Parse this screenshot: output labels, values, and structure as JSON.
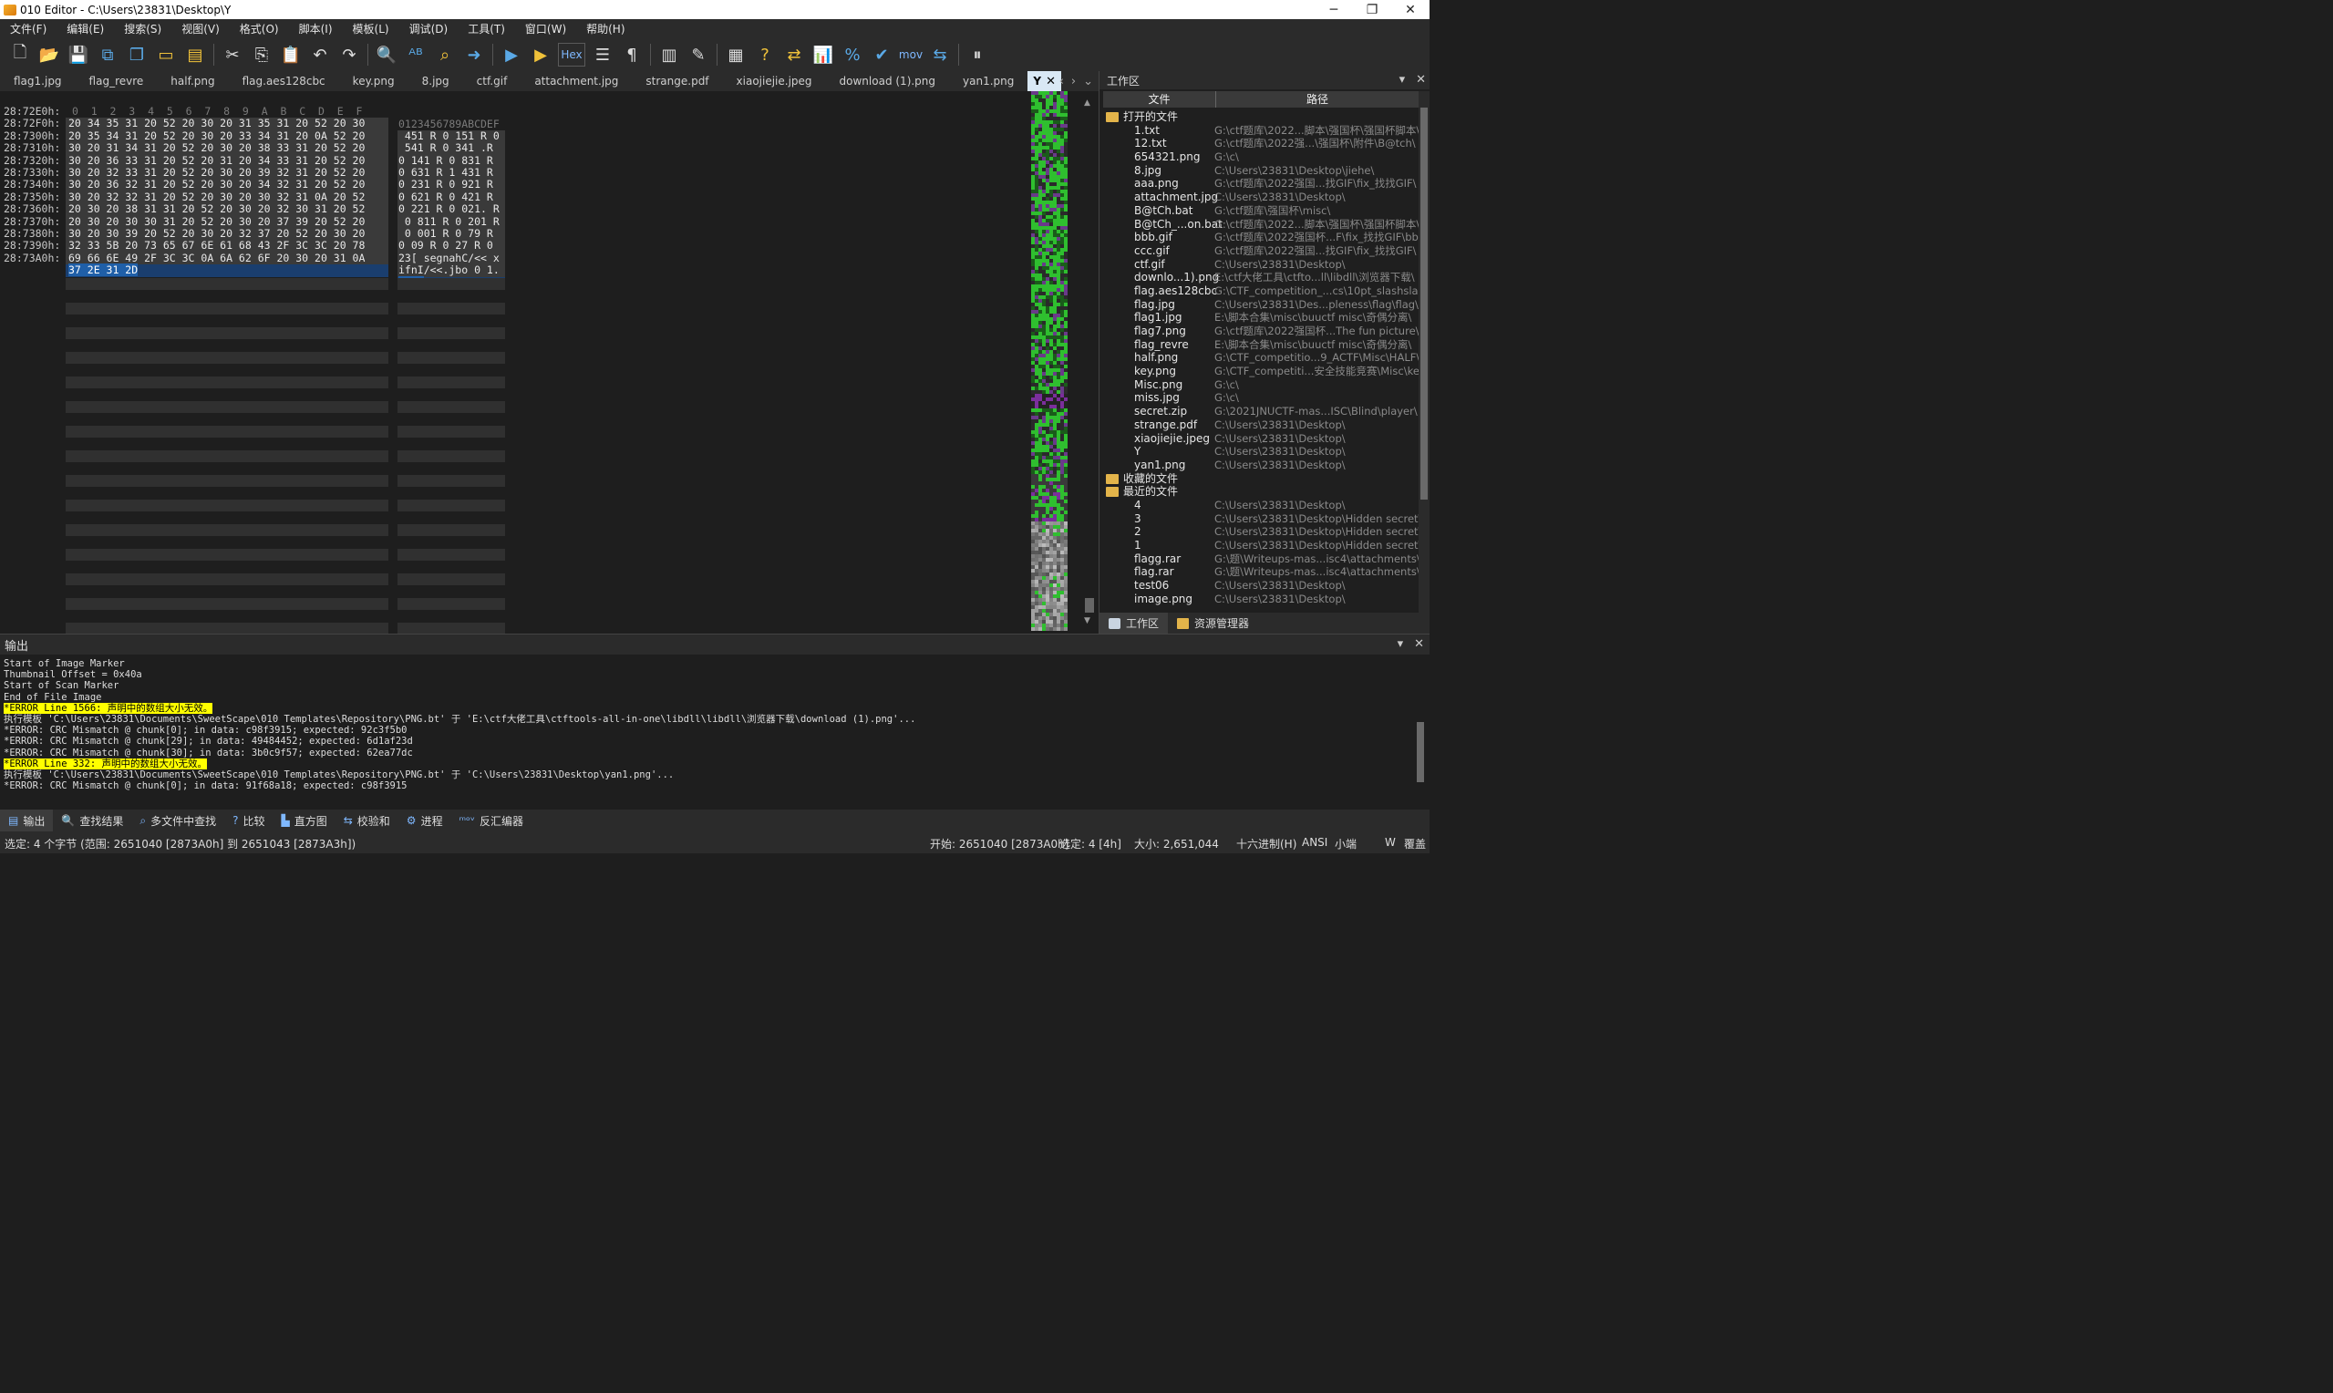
{
  "window": {
    "title": "010 Editor - C:\\Users\\23831\\Desktop\\Y",
    "minimize": "─",
    "maximize": "❐",
    "close": "✕"
  },
  "menu": [
    "文件(F)",
    "编辑(E)",
    "搜索(S)",
    "视图(V)",
    "格式(O)",
    "脚本(I)",
    "模板(L)",
    "调试(D)",
    "工具(T)",
    "窗口(W)",
    "帮助(H)"
  ],
  "toolbar": {
    "hex_label": "Hex",
    "mov_label": "mov",
    "icons": [
      "new-file-icon",
      "open-folder-icon",
      "save-icon",
      "save-as-icon",
      "save-all-icon",
      "open-dir-icon",
      "folders-icon",
      "cut-icon",
      "copy-icon",
      "paste-icon",
      "undo-icon",
      "redo-icon",
      "find-icon",
      "replace-icon",
      "find-in-files-icon",
      "goto-icon",
      "run-script-icon",
      "run-template-icon",
      "hex-mode-icon",
      "text-mode-icon",
      "pilcrow-icon",
      "columns-icon",
      "highlight-icon",
      "calculator-icon",
      "inspector-icon",
      "compare-icon",
      "histogram-icon",
      "percent-icon",
      "checksum-icon",
      "mov-icon",
      "base-convert-icon",
      "pause-icon"
    ]
  },
  "tabs": [
    {
      "label": "flag1.jpg"
    },
    {
      "label": "flag_revre"
    },
    {
      "label": "half.png"
    },
    {
      "label": "flag.aes128cbc"
    },
    {
      "label": "key.png"
    },
    {
      "label": "8.jpg"
    },
    {
      "label": "ctf.gif"
    },
    {
      "label": "attachment.jpg"
    },
    {
      "label": "strange.pdf"
    },
    {
      "label": "xiaojiejie.jpeg"
    },
    {
      "label": "download (1).png"
    },
    {
      "label": "yan1.png"
    },
    {
      "label": "Y",
      "active": true
    }
  ],
  "hex": {
    "header_offsets": "0  1  2  3  4  5  6  7  8  9  A  B  C  D  E  F",
    "header_ascii": "0123456789ABCDEF",
    "rows": [
      {
        "addr": "28:72E0h:",
        "bytes": "20 34 35 31 20 52 20 30 20 31 35 31 20 52 20 30",
        "ascii": " 451 R 0 151 R 0"
      },
      {
        "addr": "28:72F0h:",
        "bytes": "20 35 34 31 20 52 20 30 20 33 34 31 20 0A 52 20",
        "ascii": " 541 R 0 341 .R "
      },
      {
        "addr": "28:7300h:",
        "bytes": "30 20 31 34 31 20 52 20 30 20 38 33 31 20 52 20",
        "ascii": "0 141 R 0 831 R "
      },
      {
        "addr": "28:7310h:",
        "bytes": "30 20 36 33 31 20 52 20 31 20 34 33 31 20 52 20",
        "ascii": "0 631 R 1 431 R "
      },
      {
        "addr": "28:7320h:",
        "bytes": "30 20 32 33 31 20 52 20 30 20 39 32 31 20 52 20",
        "ascii": "0 231 R 0 921 R "
      },
      {
        "addr": "28:7330h:",
        "bytes": "30 20 36 32 31 20 52 20 30 20 34 32 31 20 52 20",
        "ascii": "0 621 R 0 421 R "
      },
      {
        "addr": "28:7340h:",
        "bytes": "30 20 32 32 31 20 52 20 30 20 30 32 31 0A 20 52",
        "ascii": "0 221 R 0 021. R"
      },
      {
        "addr": "28:7350h:",
        "bytes": "20 30 20 38 31 31 20 52 20 30 20 32 30 31 20 52",
        "ascii": " 0 811 R 0 201 R"
      },
      {
        "addr": "28:7360h:",
        "bytes": "20 30 20 30 30 31 20 52 20 30 20 37 39 20 52 20",
        "ascii": " 0 001 R 0 79 R "
      },
      {
        "addr": "28:7370h:",
        "bytes": "30 20 30 39 20 52 20 30 20 32 37 20 52 20 30 20",
        "ascii": "0 09 R 0 27 R 0 "
      },
      {
        "addr": "28:7380h:",
        "bytes": "32 33 5B 20 73 65 67 6E 61 68 43 2F 3C 3C 20 78",
        "ascii": "23[ segnahC/<< x"
      },
      {
        "addr": "28:7390h:",
        "bytes": "69 66 6E 49 2F 3C 3C 0A 6A 62 6F 20 30 20 31 0A",
        "ascii": "ifnI/<<.jbo 0 1."
      },
      {
        "addr": "28:73A0h:",
        "bytes": "37 2E 31 2D",
        "ascii": "7.1-",
        "selected": true
      }
    ]
  },
  "workspace": {
    "title": "工作区",
    "col_file": "文件",
    "col_path": "路径",
    "group_open": "打开的文件",
    "open_files": [
      {
        "name": "1.txt",
        "path": "G:\\ctf题库\\2022...脚本\\强国杯\\强国杯脚本\\"
      },
      {
        "name": "12.txt",
        "path": "G:\\ctf题库\\2022强...\\强国杯\\附件\\B@tch\\"
      },
      {
        "name": "654321.png",
        "path": "G:\\c\\"
      },
      {
        "name": "8.jpg",
        "path": "C:\\Users\\23831\\Desktop\\jiehe\\"
      },
      {
        "name": "aaa.png",
        "path": "G:\\ctf题库\\2022强国...找GIF\\fix_找找GIF\\"
      },
      {
        "name": "attachment.jpg",
        "path": "C:\\Users\\23831\\Desktop\\"
      },
      {
        "name": "B@tCh.bat",
        "path": "G:\\ctf题库\\强国杯\\misc\\"
      },
      {
        "name": "B@tCh_...on.bat",
        "path": "G:\\ctf题库\\2022...脚本\\强国杯\\强国杯脚本\\"
      },
      {
        "name": "bbb.gif",
        "path": "G:\\ctf题库\\2022强国杯...F\\fix_找找GIF\\bbb\\"
      },
      {
        "name": "ccc.gif",
        "path": "G:\\ctf题库\\2022强国...找GIF\\fix_找找GIF\\"
      },
      {
        "name": "ctf.gif",
        "path": "C:\\Users\\23831\\Desktop\\"
      },
      {
        "name": "downlo...1).png",
        "path": "E:\\ctf大佬工具\\ctfto...ll\\libdll\\浏览器下载\\"
      },
      {
        "name": "flag.aes128cbc",
        "path": "G:\\CTF_competition_...cs\\10pt_slashslash\\"
      },
      {
        "name": "flag.jpg",
        "path": "C:\\Users\\23831\\Des...pleness\\flag\\flag\\"
      },
      {
        "name": "flag1.jpg",
        "path": "E:\\脚本合集\\misc\\buuctf misc\\奇偶分离\\"
      },
      {
        "name": "flag7.png",
        "path": "G:\\ctf题库\\2022强国杯...The fun picture\\"
      },
      {
        "name": "flag_revre",
        "path": "E:\\脚本合集\\misc\\buuctf misc\\奇偶分离\\"
      },
      {
        "name": "half.png",
        "path": "G:\\CTF_competitio...9_ACTF\\Misc\\HALF\\"
      },
      {
        "name": "key.png",
        "path": "G:\\CTF_competiti...安全技能竞赛\\Misc\\key\\"
      },
      {
        "name": "Misc.png",
        "path": "G:\\c\\"
      },
      {
        "name": "miss.jpg",
        "path": "G:\\c\\"
      },
      {
        "name": "secret.zip",
        "path": "G:\\2021JNUCTF-mas...ISC\\Blind\\player\\"
      },
      {
        "name": "strange.pdf",
        "path": "C:\\Users\\23831\\Desktop\\"
      },
      {
        "name": "xiaojiejie.jpeg",
        "path": "C:\\Users\\23831\\Desktop\\"
      },
      {
        "name": "Y",
        "path": "C:\\Users\\23831\\Desktop\\"
      },
      {
        "name": "yan1.png",
        "path": "C:\\Users\\23831\\Desktop\\"
      }
    ],
    "group_fav": "收藏的文件",
    "group_recent": "最近的文件",
    "recent_files": [
      {
        "name": "4",
        "path": "C:\\Users\\23831\\Desktop\\"
      },
      {
        "name": "3",
        "path": "C:\\Users\\23831\\Desktop\\Hidden secret\\"
      },
      {
        "name": "2",
        "path": "C:\\Users\\23831\\Desktop\\Hidden secret\\"
      },
      {
        "name": "1",
        "path": "C:\\Users\\23831\\Desktop\\Hidden secret\\"
      },
      {
        "name": "flagg.rar",
        "path": "G:\\题\\Writeups-mas...isc4\\attachments\\"
      },
      {
        "name": "flag.rar",
        "path": "G:\\题\\Writeups-mas...isc4\\attachments\\"
      },
      {
        "name": "test06",
        "path": "C:\\Users\\23831\\Desktop\\"
      },
      {
        "name": "image.png",
        "path": "C:\\Users\\23831\\Desktop\\"
      }
    ],
    "tab_workspace": "工作区",
    "tab_explorer": "资源管理器"
  },
  "output": {
    "title": "输出",
    "lines": [
      {
        "text": "Start of Image Marker"
      },
      {
        "text": "Thumbnail Offset = 0x40a"
      },
      {
        "text": "Start of Scan Marker"
      },
      {
        "text": "End of File Image"
      },
      {
        "text": "*ERROR Line 1566: 声明中的数组大小无效。",
        "highlight": true
      },
      {
        "text": "执行模板 'C:\\Users\\23831\\Documents\\SweetScape\\010 Templates\\Repository\\PNG.bt' 于 'E:\\ctf大佬工具\\ctftools-all-in-one\\libdll\\libdll\\浏览器下载\\download (1).png'..."
      },
      {
        "text": "*ERROR: CRC Mismatch @ chunk[0]; in data: c98f3915; expected: 92c3f5b0"
      },
      {
        "text": "*ERROR: CRC Mismatch @ chunk[29]; in data: 49484452; expected: 6d1af23d"
      },
      {
        "text": "*ERROR: CRC Mismatch @ chunk[30]; in data: 3b0c9f57; expected: 62ea77dc"
      },
      {
        "text": "*ERROR Line 332: 声明中的数组大小无效。",
        "highlight": true
      },
      {
        "text": "执行模板 'C:\\Users\\23831\\Documents\\SweetScape\\010 Templates\\Repository\\PNG.bt' 于 'C:\\Users\\23831\\Desktop\\yan1.png'..."
      },
      {
        "text": "*ERROR: CRC Mismatch @ chunk[0]; in data: 91f68a18; expected: c98f3915"
      }
    ]
  },
  "bottom_tabs": [
    {
      "label": "输出",
      "icon": "output-icon",
      "active": true
    },
    {
      "label": "查找结果",
      "icon": "find-results-icon"
    },
    {
      "label": "多文件中查找",
      "icon": "find-in-files-icon"
    },
    {
      "label": "比较",
      "icon": "compare-icon"
    },
    {
      "label": "直方图",
      "icon": "histogram-icon"
    },
    {
      "label": "校验和",
      "icon": "checksum-icon"
    },
    {
      "label": "进程",
      "icon": "process-icon"
    },
    {
      "label": "反汇编器",
      "icon": "disassembler-icon"
    }
  ],
  "status": {
    "selection": "选定: 4 个字节 (范围: 2651040 [2873A0h] 到 2651043 [2873A3h])",
    "start": "开始: 2651040 [2873A0h]",
    "sel_len": "选定: 4 [4h]",
    "size": "大小: 2,651,044",
    "base": "十六进制(H)",
    "encoding": "ANSI",
    "endian": "小端",
    "w": "W",
    "mode": "覆盖"
  }
}
